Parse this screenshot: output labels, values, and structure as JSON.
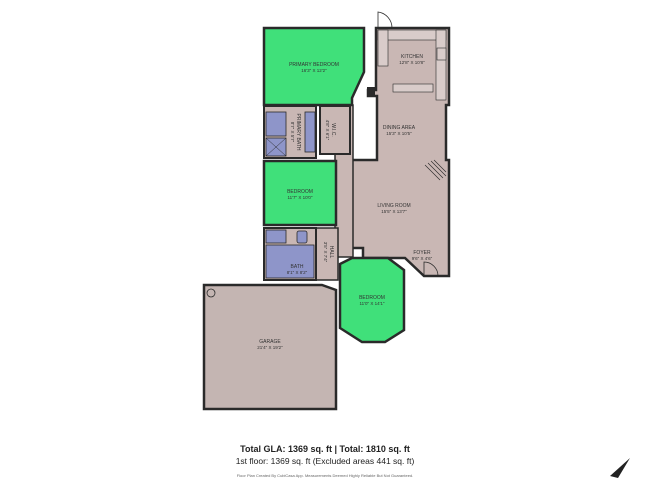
{
  "colors": {
    "room_fill": "#c9b7b4",
    "bedroom_fill": "#40e07a",
    "bath_fill": "#8e95c9",
    "wall": "#2a2a2a",
    "garage_fill": "#c4b5b2"
  },
  "rooms": {
    "primary_bedroom": {
      "name": "PRIMARY BEDROOM",
      "dims": "16'3\" X 12'2\""
    },
    "kitchen": {
      "name": "KITCHEN",
      "dims": "12'8\" X 10'8\""
    },
    "primary_bath": {
      "name": "PRIMARY BATH",
      "dims": "8'7\" X 5'7\""
    },
    "wic": {
      "name": "W.I.C.",
      "dims": "4'8\" X 6'1\""
    },
    "dining_area": {
      "name": "DINING AREA",
      "dims": "15'3\" X 10'5\""
    },
    "bedroom_1": {
      "name": "BEDROOM",
      "dims": "11'7\" X 10'0\""
    },
    "living_room": {
      "name": "LIVING ROOM",
      "dims": "15'5\" X 13'7\""
    },
    "foyer": {
      "name": "FOYER",
      "dims": "9'6\" X 4'6\""
    },
    "hall": {
      "name": "HALL",
      "dims": "3'5\" X 7'4\""
    },
    "bath": {
      "name": "BATH",
      "dims": "8'1\" X 8'2\""
    },
    "bedroom_2": {
      "name": "BEDROOM",
      "dims": "11'0\" X 14'1\""
    },
    "garage": {
      "name": "GARAGE",
      "dims": "21'4\" X 19'2\""
    }
  },
  "footer": {
    "totals": "Total GLA: 1369 sq. ft | Total: 1810 sq. ft",
    "first_floor": "1st floor: 1369 sq. ft (Excluded areas 441 sq. ft)",
    "disclaimer": "Floor Plan Created By CubiCasa App. Measurements Deemed Highly Reliable But Not Guaranteed."
  }
}
